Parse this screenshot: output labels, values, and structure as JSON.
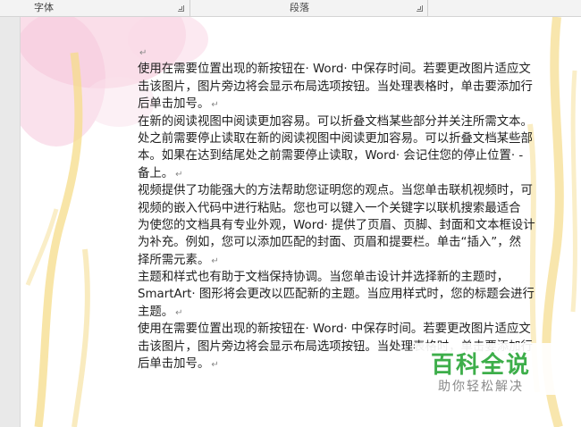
{
  "ribbon": {
    "font_group_label": "字体",
    "paragraph_group_label": "段落"
  },
  "document": {
    "lines": [
      "",
      "使用在需要位置出现的新按钮在· Word· 中保存时间。若要更改图片适应文",
      "击该图片，图片旁边将会显示布局选项按钮。当处理表格时，单击要添加行",
      "后单击加号。",
      "在新的阅读视图中阅读更加容易。可以折叠文档某些部分并关注所需文本。",
      "处之前需要停止读取在新的阅读视图中阅读更加容易。可以折叠文档某些部",
      "本。如果在达到结尾处之前需要停止读取，Word· 会记住您的停止位置· -",
      "备上。",
      "视频提供了功能强大的方法帮助您证明您的观点。当您单击联机视频时，可",
      "视频的嵌入代码中进行粘贴。您也可以键入一个关键字以联机搜索最适合",
      "为使您的文档具有专业外观，Word· 提供了页眉、页脚、封面和文本框设计",
      "为补充。例如，您可以添加匹配的封面、页眉和提要栏。单击“插入”，然",
      "择所需元素。",
      "主题和样式也有助于文档保持协调。当您单击设计并选择新的主题时，",
      "SmartArt· 图形将会更改以匹配新的主题。当应用样式时，您的标题会进行",
      "主题。",
      "使用在需要位置出现的新按钮在· Word· 中保存时间。若要更改图片适应文",
      "击该图片，图片旁边将会显示布局选项按钮。当处理表格时，单击要添加行",
      "后单击加号。"
    ],
    "paragraph_mark": "↵"
  },
  "watermark": {
    "title": "百科全说",
    "subtitle": "助你轻松解决"
  },
  "colors": {
    "ribbon_bg": "#f3f3f3",
    "watermark_green": "#3dae4a",
    "petal_pink": "#f6c9dc",
    "stem_yellow": "#f5dc8a"
  }
}
